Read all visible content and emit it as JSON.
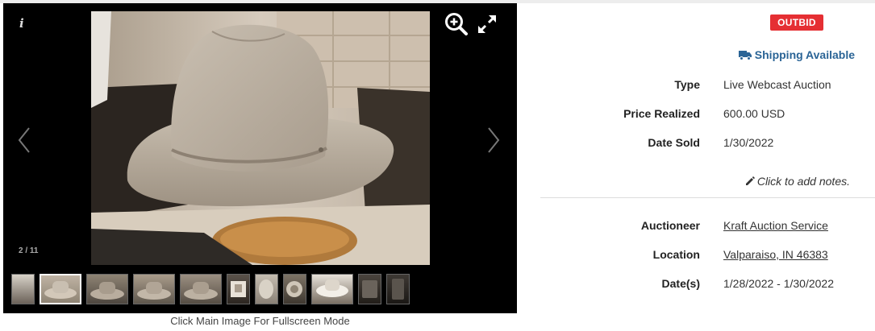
{
  "viewer": {
    "counter": "2 / 11",
    "caption": "Click Main Image For Fullscreen Mode",
    "info_icon": "i",
    "icons": [
      "info-icon",
      "zoom-in-icon",
      "fullscreen-icon",
      "chevron-left-icon",
      "chevron-right-icon"
    ]
  },
  "status": {
    "badge": "OUTBID",
    "badge_color": "#e52f33",
    "shipping": "Shipping Available",
    "shipping_color": "#2a6496"
  },
  "details": {
    "type_label": "Type",
    "type_value": "Live Webcast Auction",
    "price_label": "Price Realized",
    "price_value": "600.00 USD",
    "sold_label": "Date Sold",
    "sold_value": "1/30/2022",
    "notes": "Click to add notes.",
    "auctioneer_label": "Auctioneer",
    "auctioneer_value": "Kraft Auction Service",
    "location_label": "Location",
    "location_value": "Valparaiso, IN 46383",
    "dates_label": "Date(s)",
    "dates_value": "1/28/2022 - 1/30/2022"
  }
}
